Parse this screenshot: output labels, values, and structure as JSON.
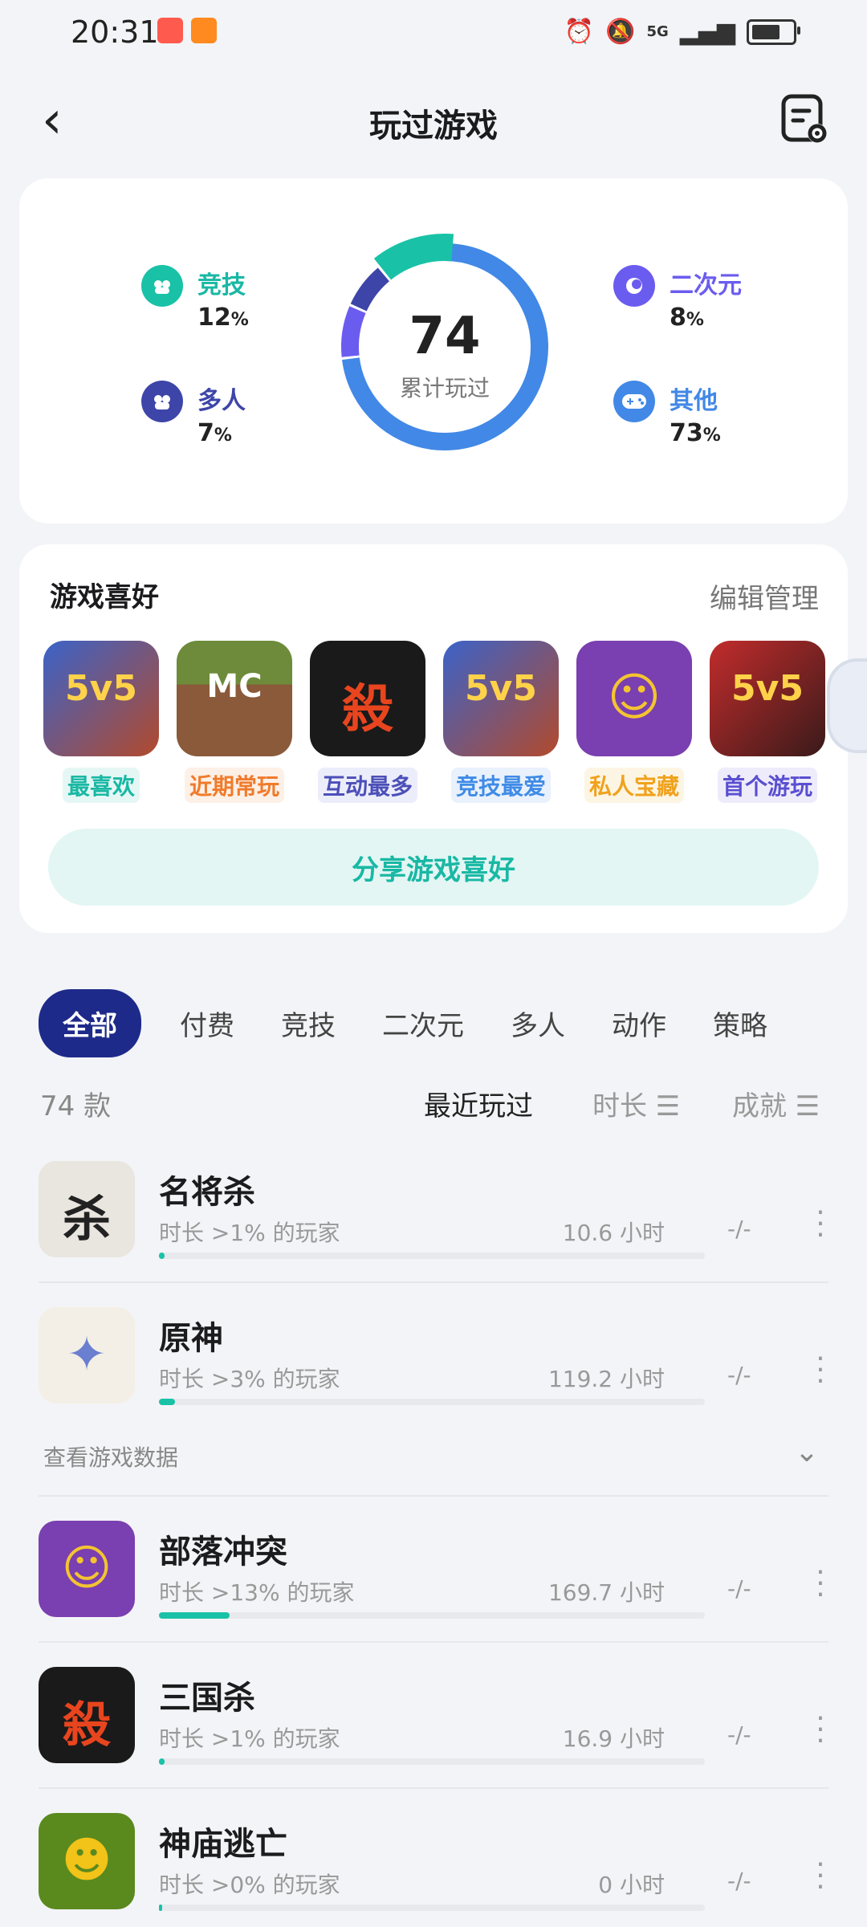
{
  "status_bar": {
    "time": "20:31",
    "network": "5G"
  },
  "header": {
    "title": "玩过游戏"
  },
  "stats": {
    "total": "74",
    "total_label": "累计玩过",
    "categories": [
      {
        "name": "竞技",
        "value": "12",
        "unit": "%",
        "color": "#19c2a7"
      },
      {
        "name": "多人",
        "value": "7",
        "unit": "%",
        "color": "#3d45a8"
      },
      {
        "name": "二次元",
        "value": "8",
        "unit": "%",
        "color": "#6b5cf0"
      },
      {
        "name": "其他",
        "value": "73",
        "unit": "%",
        "color": "#4288e6"
      }
    ]
  },
  "prefs": {
    "title": "游戏喜好",
    "edit_label": "编辑管理",
    "games": [
      {
        "tag": "最喜欢",
        "tag_color": "#19b8a4",
        "tag_bg": "#e5f7f4",
        "glyph": "5v5",
        "bg": "#b24a2c"
      },
      {
        "tag": "近期常玩",
        "tag_color": "#f07b2c",
        "tag_bg": "#fdf0e6",
        "glyph": "MC",
        "bg": "#6d8b3a"
      },
      {
        "tag": "互动最多",
        "tag_color": "#4b4fb8",
        "tag_bg": "#ecedfa",
        "glyph": "殺",
        "bg": "#1a1a1a"
      },
      {
        "tag": "竞技最爱",
        "tag_color": "#3f8be6",
        "tag_bg": "#e9f1fd",
        "glyph": "5v5",
        "bg": "#b24a2c"
      },
      {
        "tag": "私人宝藏",
        "tag_color": "#f0a21c",
        "tag_bg": "#fdf5e4",
        "glyph": "☺",
        "bg": "#7a3fb0"
      },
      {
        "tag": "首个游玩",
        "tag_color": "#5a4fd0",
        "tag_bg": "#eeecfb",
        "glyph": "5v5",
        "bg": "#c22c2c"
      }
    ],
    "share_label": "分享游戏喜好"
  },
  "tabs": [
    "全部",
    "付费",
    "竞技",
    "二次元",
    "多人",
    "动作",
    "策略"
  ],
  "sort": {
    "count": "74 款",
    "options": [
      "最近玩过",
      "时长 ☰",
      "成就 ☰"
    ]
  },
  "games": [
    {
      "name": "名将杀",
      "sub": "时长 >1% 的玩家",
      "hours": "10.6 小时",
      "ach": "-/-",
      "pct": 1,
      "glyph": "杀",
      "bg": "#e9e5df",
      "fg": "#222"
    },
    {
      "name": "原神",
      "sub": "时长 >3% 的玩家",
      "hours": "119.2 小时",
      "ach": "-/-",
      "pct": 3,
      "glyph": "✦",
      "bg": "#f4efe6",
      "fg": "#6b7fd0"
    },
    {
      "name": "部落冲突",
      "sub": "时长 >13% 的玩家",
      "hours": "169.7 小时",
      "ach": "-/-",
      "pct": 13,
      "glyph": "☺",
      "bg": "#7a3fb0",
      "fg": "#f4c430"
    },
    {
      "name": "三国杀",
      "sub": "时长 >1% 的玩家",
      "hours": "16.9 小时",
      "ach": "-/-",
      "pct": 1,
      "glyph": "殺",
      "bg": "#1a1a1a",
      "fg": "#e8451f"
    },
    {
      "name": "神庙逃亡",
      "sub": "时长 >0% 的玩家",
      "hours": "0 小时",
      "ach": "-/-",
      "pct": 0,
      "glyph": "☻",
      "bg": "#5a8a1e",
      "fg": "#f2c318"
    }
  ],
  "view_data_label": "查看游戏数据"
}
